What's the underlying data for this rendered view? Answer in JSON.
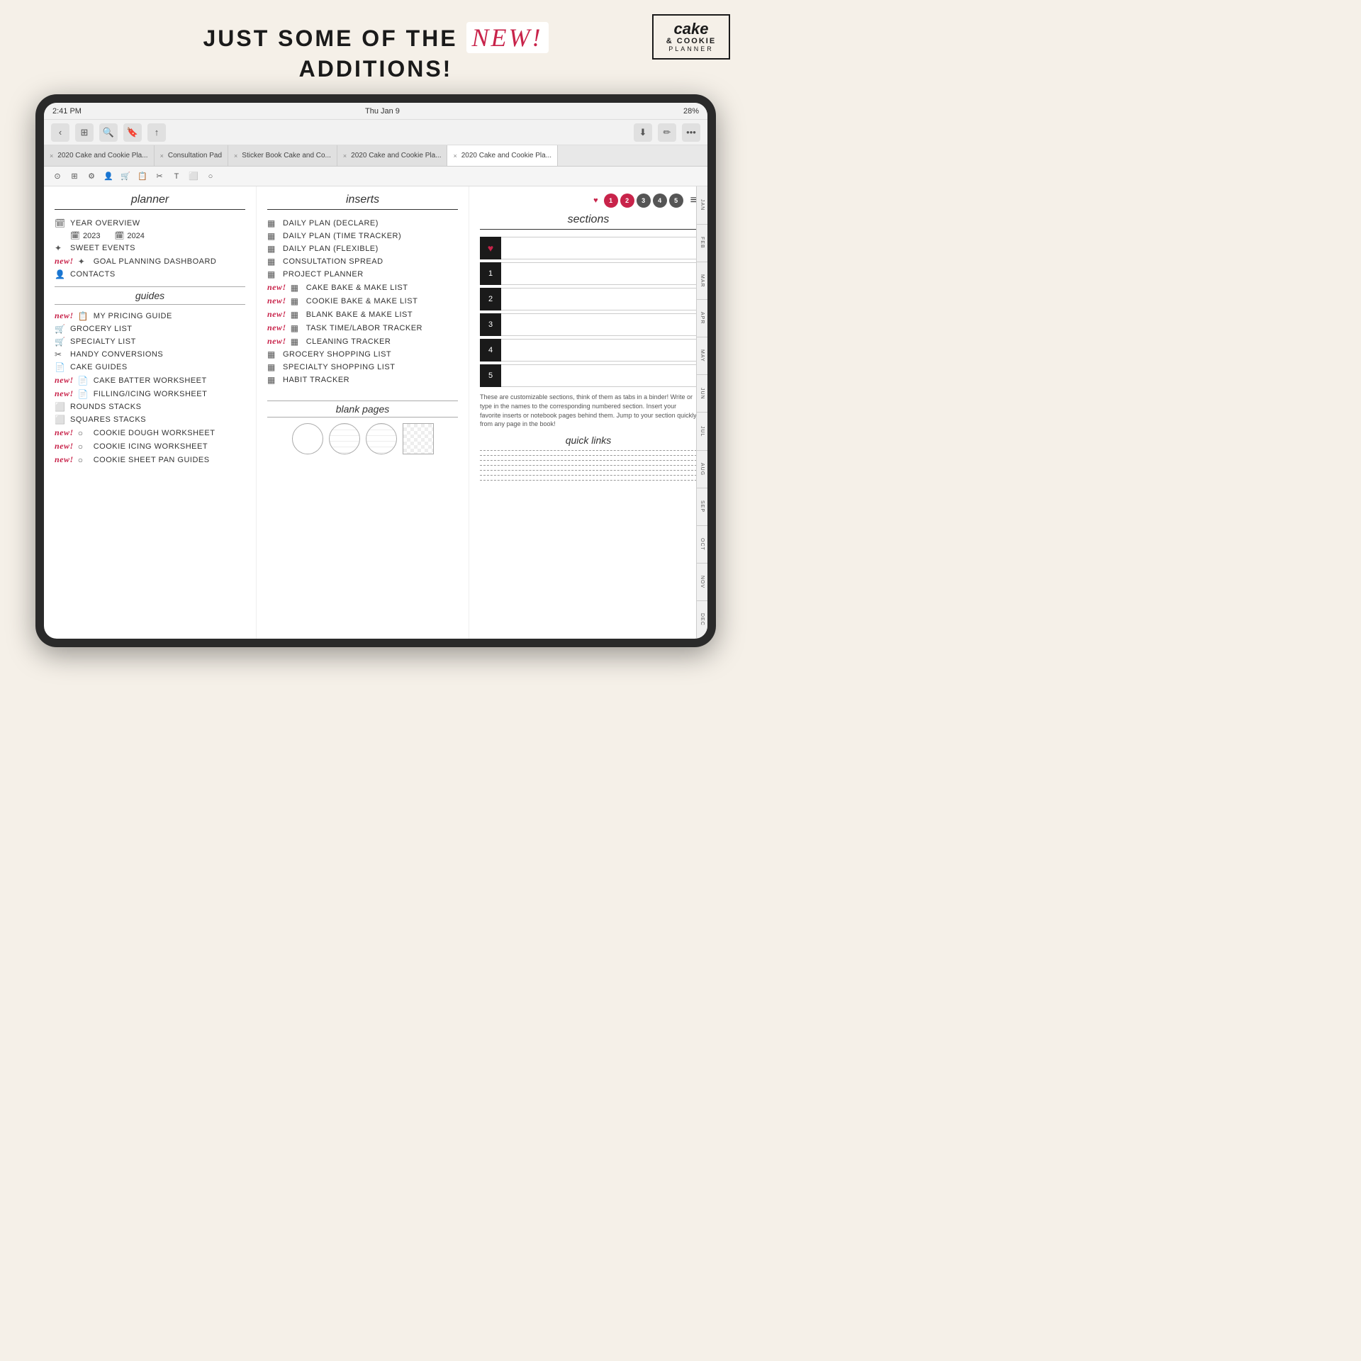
{
  "header": {
    "line1": "JUST SOME OF THE",
    "new_badge": "new!",
    "line2": "ADDITIONS!",
    "logo": {
      "line1": "cake",
      "line2": "& COOKIE",
      "line3": "PLANNER"
    }
  },
  "status_bar": {
    "time": "2:41 PM",
    "date": "Thu Jan 9",
    "battery": "28%"
  },
  "tabs": [
    {
      "label": "2020 Cake and Cookie Pla...",
      "active": false
    },
    {
      "label": "Consultation Pad",
      "active": false
    },
    {
      "label": "Sticker Book Cake and Co...",
      "active": false
    },
    {
      "label": "2020 Cake and Cookie Pla...",
      "active": false
    },
    {
      "label": "2020 Cake and Cookie Pla...",
      "active": true
    }
  ],
  "planner_col": {
    "header": "planner",
    "items": [
      {
        "icon": "🗓",
        "text": "YEAR OVERVIEW",
        "new": false
      },
      {
        "year_items": [
          "2023",
          "2024"
        ]
      },
      {
        "icon": "✦",
        "text": "SWEET EVENTS",
        "new": false
      },
      {
        "icon": "✦",
        "text": "GOAL PLANNING DASHBOARD",
        "new": true
      },
      {
        "icon": "👤",
        "text": "CONTACTS",
        "new": false
      }
    ],
    "guides_header": "guides",
    "guides": [
      {
        "icon": "📋",
        "text": "MY PRICING GUIDE",
        "new": true
      },
      {
        "icon": "🛒",
        "text": "GROCERY LIST",
        "new": false
      },
      {
        "icon": "🛒",
        "text": "SPECIALTY LIST",
        "new": false
      },
      {
        "icon": "✂",
        "text": "HANDY CONVERSIONS",
        "new": false
      },
      {
        "icon": "📄",
        "text": "CAKE GUIDES",
        "new": false
      },
      {
        "icon": "📄",
        "text": "CAKE BATTER WORKSHEET",
        "new": true
      },
      {
        "icon": "📄",
        "text": "FILLING/ICING WORKSHEET",
        "new": true
      },
      {
        "icon": "⬜",
        "text": "ROUNDS STACKS",
        "new": false
      },
      {
        "icon": "⬜",
        "text": "SQUARES STACKS",
        "new": false
      },
      {
        "icon": "○",
        "text": "COOKIE DOUGH WORKSHEET",
        "new": true
      },
      {
        "icon": "○",
        "text": "COOKIE ICING WORKSHEET",
        "new": true
      },
      {
        "icon": "○",
        "text": "COOKIE SHEET PAN GUIDES",
        "new": true
      }
    ]
  },
  "inserts_col": {
    "header": "inserts",
    "items": [
      {
        "icon": "▦",
        "text": "DAILY PLAN (DECLARE)",
        "new": false
      },
      {
        "icon": "▦",
        "text": "DAILY PLAN (TIME TRACKER)",
        "new": false
      },
      {
        "icon": "▦",
        "text": "DAILY PLAN (FLEXIBLE)",
        "new": false
      },
      {
        "icon": "▦",
        "text": "CONSULTATION SPREAD",
        "new": false
      },
      {
        "icon": "▦",
        "text": "PROJECT PLANNER",
        "new": false
      },
      {
        "icon": "▦",
        "text": "CAKE BAKE & MAKE LIST",
        "new": true
      },
      {
        "icon": "▦",
        "text": "COOKIE BAKE & MAKE LIST",
        "new": true
      },
      {
        "icon": "▦",
        "text": "BLANK BAKE & MAKE LIST",
        "new": true
      },
      {
        "icon": "▦",
        "text": "TASK TIME/LABOR TRACKER",
        "new": true
      },
      {
        "icon": "▦",
        "text": "CLEANING TRACKER",
        "new": true
      },
      {
        "icon": "▦",
        "text": "GROCERY SHOPPING LIST",
        "new": false
      },
      {
        "icon": "▦",
        "text": "SPECIALTY SHOPPING LIST",
        "new": false
      },
      {
        "icon": "▦",
        "text": "HABIT TRACKER",
        "new": false
      }
    ],
    "blank_pages": {
      "header": "blank pages"
    }
  },
  "sections_col": {
    "header": "sections",
    "rows": [
      {
        "label": "♥",
        "type": "heart"
      },
      {
        "label": "1",
        "type": "number"
      },
      {
        "label": "2",
        "type": "number"
      },
      {
        "label": "3",
        "type": "number"
      },
      {
        "label": "4",
        "type": "number"
      },
      {
        "label": "5",
        "type": "number"
      }
    ],
    "description": "These are customizable sections, think of them as tabs in a binder! Write or type in the names to the corresponding numbered section. Insert your favorite inserts or notebook pages behind them. Jump to your section quickly from any page in the book!",
    "quick_links_title": "quick links"
  },
  "months": [
    "JAN",
    "FEB",
    "MAR",
    "APR",
    "MAY",
    "JUN",
    "JUL",
    "AUG",
    "SEP",
    "OCT",
    "NOV",
    "DEC"
  ]
}
